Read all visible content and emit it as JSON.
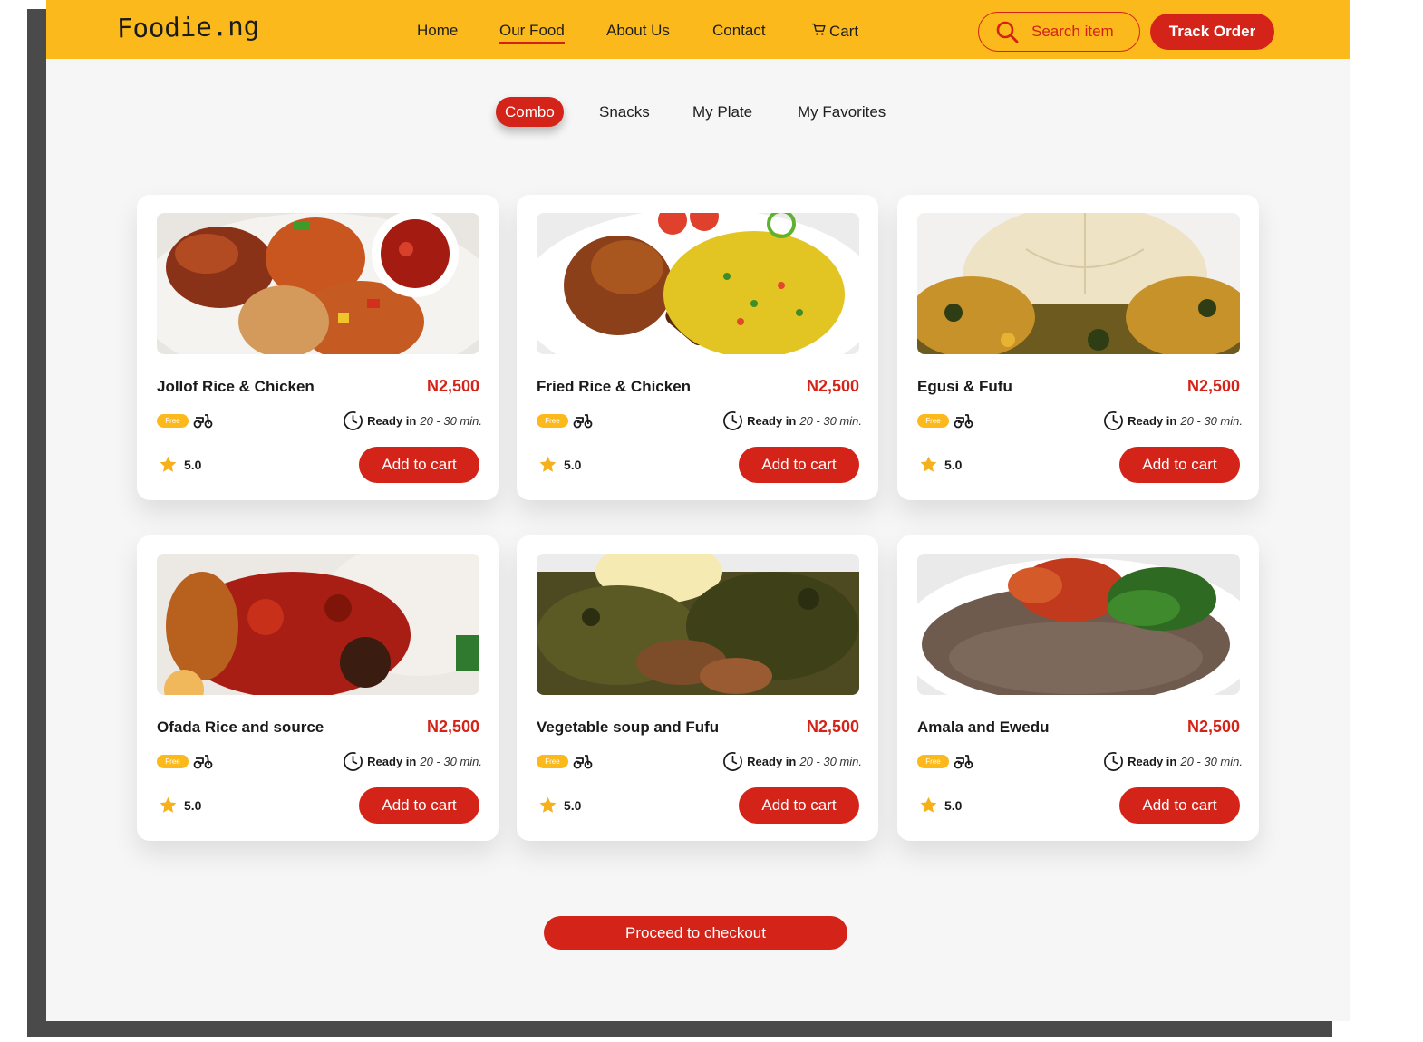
{
  "brand": {
    "logo": "Foodie.ng"
  },
  "nav": {
    "items": [
      {
        "label": "Home"
      },
      {
        "label": "Our Food",
        "active": true
      },
      {
        "label": "About Us"
      },
      {
        "label": "Contact"
      },
      {
        "label": "Cart",
        "icon": "cart-icon"
      }
    ]
  },
  "search": {
    "placeholder": "Search item",
    "icon": "search-icon"
  },
  "track_order": {
    "label": "Track Order"
  },
  "categories": [
    {
      "label": "Combo",
      "active": true
    },
    {
      "label": "Snacks"
    },
    {
      "label": "My Plate"
    },
    {
      "label": "My Favorites"
    }
  ],
  "products": [
    {
      "name": "Jollof Rice & Chicken",
      "price": "N2,500",
      "badge": "Free",
      "ready_label": "Ready in",
      "ready_time": "20 - 30 min.",
      "rating": "5.0",
      "cta": "Add to cart"
    },
    {
      "name": "Fried Rice & Chicken",
      "price": "N2,500",
      "badge": "Free",
      "ready_label": "Ready in",
      "ready_time": "20 - 30 min.",
      "rating": "5.0",
      "cta": "Add to cart"
    },
    {
      "name": "Egusi & Fufu",
      "price": "N2,500",
      "badge": "Free",
      "ready_label": "Ready in",
      "ready_time": "20 - 30 min.",
      "rating": "5.0",
      "cta": "Add to cart"
    },
    {
      "name": "Ofada Rice and source",
      "price": "N2,500",
      "badge": "Free",
      "ready_label": "Ready in",
      "ready_time": "20 - 30 min.",
      "rating": "5.0",
      "cta": "Add to cart"
    },
    {
      "name": "Vegetable soup and Fufu",
      "price": "N2,500",
      "badge": "Free",
      "ready_label": "Ready in",
      "ready_time": "20 - 30 min.",
      "rating": "5.0",
      "cta": "Add to cart"
    },
    {
      "name": "Amala and Ewedu",
      "price": "N2,500",
      "badge": "Free",
      "ready_label": "Ready in",
      "ready_time": "20 - 30 min.",
      "rating": "5.0",
      "cta": "Add to cart"
    }
  ],
  "checkout": {
    "label": "Proceed to checkout"
  },
  "colors": {
    "brand_yellow": "#fbb91c",
    "accent_red": "#d42318",
    "page_bg": "#f6f6f6"
  }
}
